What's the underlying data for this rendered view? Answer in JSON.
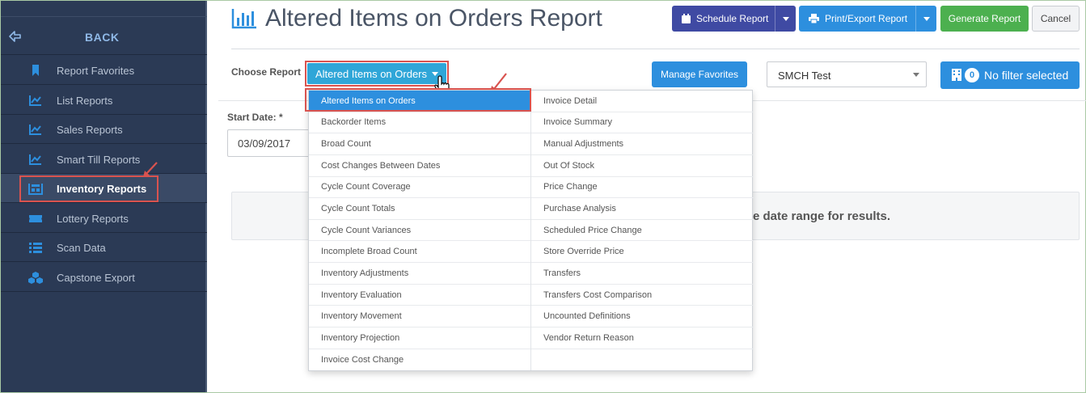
{
  "sidebar": {
    "back_label": "BACK",
    "items": [
      {
        "label": "Report Favorites",
        "icon": "bookmark-icon"
      },
      {
        "label": "List Reports",
        "icon": "line-chart-icon"
      },
      {
        "label": "Sales Reports",
        "icon": "line-chart-icon"
      },
      {
        "label": "Smart Till Reports",
        "icon": "line-chart-icon"
      },
      {
        "label": "Inventory Reports",
        "icon": "inventory-icon",
        "active": true
      },
      {
        "label": "Lottery Reports",
        "icon": "ticket-icon"
      },
      {
        "label": "Scan Data",
        "icon": "list-icon"
      },
      {
        "label": "Capstone Export",
        "icon": "cubes-icon"
      }
    ]
  },
  "header": {
    "title": "Altered Items on Orders Report",
    "schedule_label": "Schedule Report",
    "print_label": "Print/Export Report",
    "generate_label": "Generate Report",
    "cancel_label": "Cancel"
  },
  "toolbar": {
    "choose_label": "Choose Report",
    "report_selected": "Altered Items on Orders",
    "manage_label": "Manage Favorites",
    "store_value": "SMCH Test",
    "filter_count": "0",
    "filter_label": "No filter selected"
  },
  "form": {
    "start_label": "Start Date: *",
    "start_value": "03/09/2017",
    "results_text": "e date range for results."
  },
  "dropdown": {
    "left": [
      "Altered Items on Orders",
      "Backorder Items",
      "Broad Count",
      "Cost Changes Between Dates",
      "Cycle Count Coverage",
      "Cycle Count Totals",
      "Cycle Count Variances",
      "Incomplete Broad Count",
      "Inventory Adjustments",
      "Inventory Evaluation",
      "Inventory Movement",
      "Inventory Projection",
      "Invoice Cost Change"
    ],
    "right": [
      "Invoice Detail",
      "Invoice Summary",
      "Manual Adjustments",
      "Out Of Stock",
      "Price Change",
      "Purchase Analysis",
      "Scheduled Price Change",
      "Store Override Price",
      "Transfers",
      "Transfers Cost Comparison",
      "Uncounted Definitions",
      "Vendor Return Reason"
    ]
  },
  "colors": {
    "sidebar_bg": "#2b3a55",
    "accent_blue": "#2d8fde",
    "purple": "#3f4aa3",
    "green": "#4cb04f",
    "highlight_red": "#d9534f"
  }
}
